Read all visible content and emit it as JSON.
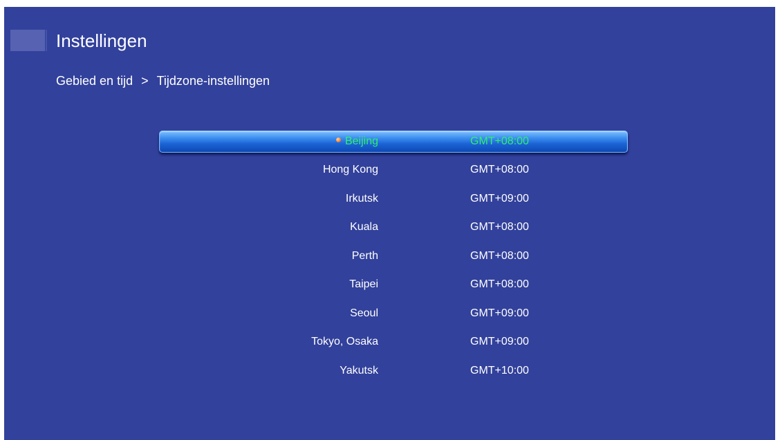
{
  "header": {
    "title": "Instellingen"
  },
  "breadcrumb": {
    "parent": "Gebied en tijd",
    "separator": ">",
    "current": "Tijdzone-instellingen"
  },
  "timezones": [
    {
      "city": "Beijing",
      "offset": "GMT+08:00",
      "selected": true
    },
    {
      "city": "Hong Kong",
      "offset": "GMT+08:00",
      "selected": false
    },
    {
      "city": "Irkutsk",
      "offset": "GMT+09:00",
      "selected": false
    },
    {
      "city": "Kuala",
      "offset": "GMT+08:00",
      "selected": false
    },
    {
      "city": "Perth",
      "offset": "GMT+08:00",
      "selected": false
    },
    {
      "city": "Taipei",
      "offset": "GMT+08:00",
      "selected": false
    },
    {
      "city": "Seoul",
      "offset": "GMT+09:00",
      "selected": false
    },
    {
      "city": "Tokyo, Osaka",
      "offset": "GMT+09:00",
      "selected": false
    },
    {
      "city": "Yakutsk",
      "offset": "GMT+10:00",
      "selected": false
    }
  ],
  "colors": {
    "background": "#32419b",
    "selected_text": "#2cf26b",
    "highlight": "#1a62d4",
    "selected_dot": "#ff8c3a"
  }
}
